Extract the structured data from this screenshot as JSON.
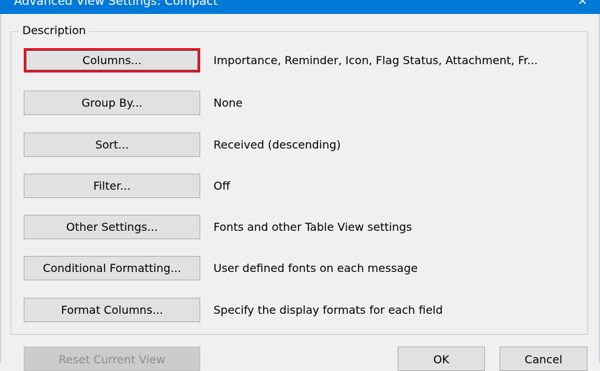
{
  "window": {
    "title": "Advanced View Settings: Compact",
    "close_glyph": "✕"
  },
  "group": {
    "legend": "Description"
  },
  "rows": [
    {
      "button_label": "Columns...",
      "description": "Importance, Reminder, Icon, Flag Status, Attachment, Fr..."
    },
    {
      "button_label": "Group By...",
      "description": "None"
    },
    {
      "button_label": "Sort...",
      "description": "Received (descending)"
    },
    {
      "button_label": "Filter...",
      "description": "Off"
    },
    {
      "button_label": "Other Settings...",
      "description": "Fonts and other Table View settings"
    },
    {
      "button_label": "Conditional Formatting...",
      "description": "User defined fonts on each message"
    },
    {
      "button_label": "Format Columns...",
      "description": "Specify the display formats for each field"
    }
  ],
  "footer": {
    "reset_label": "Reset Current View",
    "ok_label": "OK",
    "cancel_label": "Cancel"
  },
  "colors": {
    "titlebar": "#0078d7",
    "focus_ring": "#e81123",
    "button_face": "#e1e1e1",
    "dialog_bg": "#f0f0f0"
  }
}
